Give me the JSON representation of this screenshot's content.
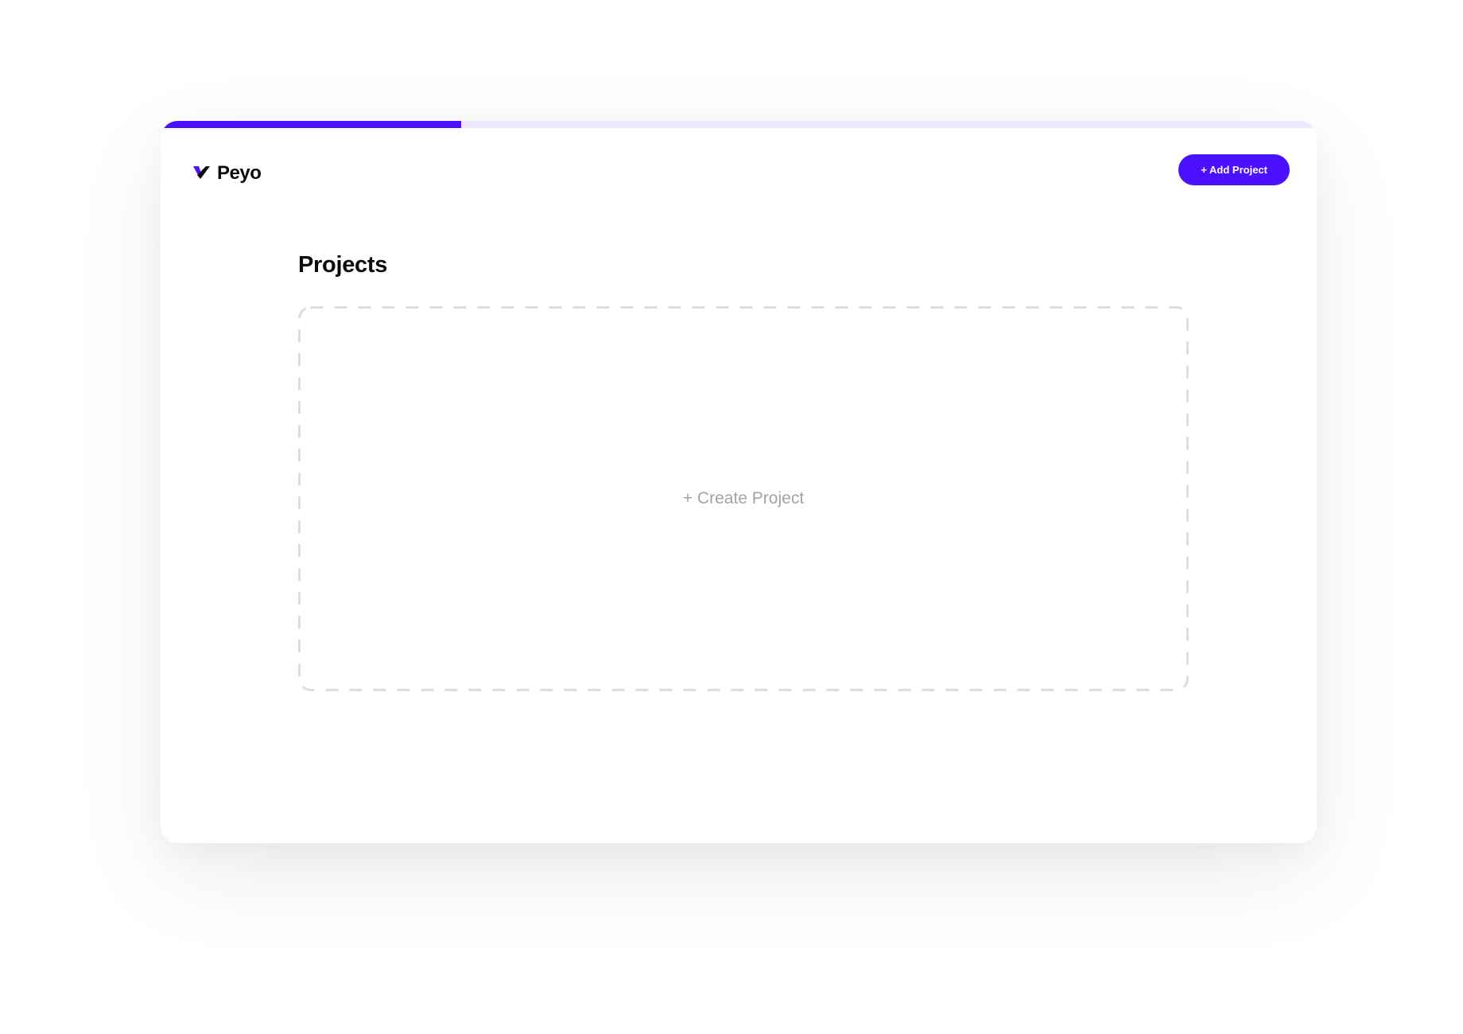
{
  "app": {
    "brand_name": "Peyo",
    "logo_icon": "peyo-checkmark-icon"
  },
  "progress": {
    "fraction": 0.26,
    "fill_color": "#4a10ff",
    "track_color": "#ede8ff"
  },
  "header": {
    "add_project_label": "+ Add Project"
  },
  "main": {
    "title": "Projects",
    "create_project_label": "+ Create Project"
  },
  "colors": {
    "accent": "#4a10ff",
    "muted_text": "#a3a3a3",
    "dashed_border": "#dddddd"
  }
}
